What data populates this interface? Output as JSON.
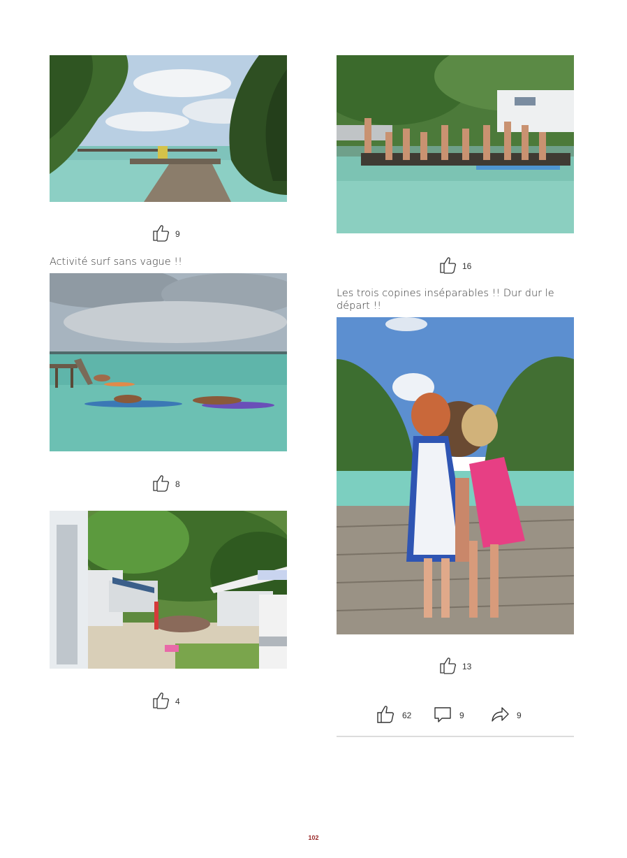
{
  "left_column": {
    "photo1": {
      "likes": "9",
      "alt": ""
    },
    "caption_surf": "Activité surf sans vague !!",
    "photo2": {
      "likes": "8"
    },
    "photo3": {
      "likes": "4"
    }
  },
  "right_column": {
    "photo1": {
      "likes": "16"
    },
    "caption_copines": "Les trois copines inséparables !! Dur dur le départ !!",
    "photo2": {
      "likes": "13"
    }
  },
  "stats": {
    "likes": "62",
    "comments": "9",
    "shares": "9"
  },
  "icons": {
    "like": "thumbs-up-icon",
    "comment": "speech-bubble-icon",
    "share": "share-arrow-icon"
  },
  "colors": {
    "page_number": "#9a2a2a",
    "divider": "#dcdcdc"
  },
  "page_number": "102"
}
